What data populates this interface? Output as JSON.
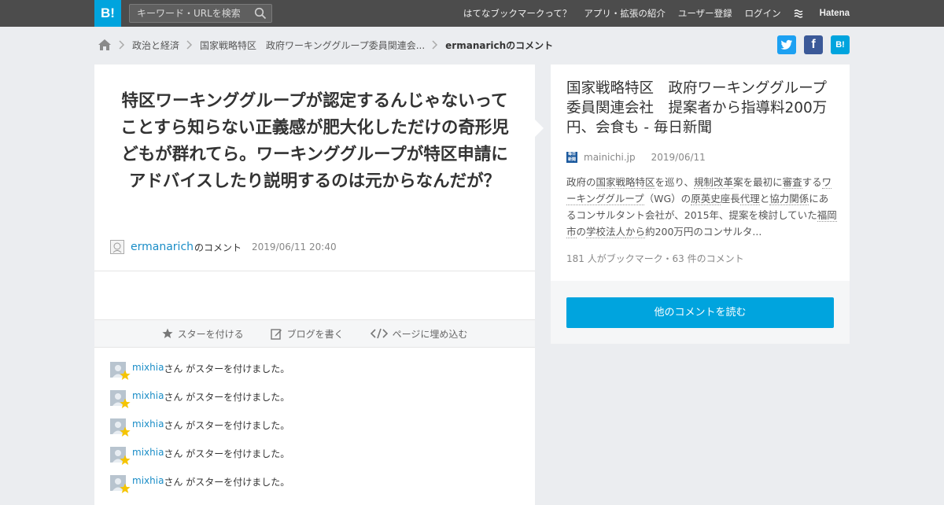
{
  "header": {
    "logo_text": "B!",
    "search_placeholder": "キーワード・URLを検索",
    "nav": [
      "はてなブックマークって？",
      "アプリ・拡張の紹介",
      "ユーザー登録",
      "ログイン"
    ],
    "hatena_label": "Hatena"
  },
  "breadcrumb": {
    "items": [
      "政治と経済",
      "国家戦略特区　政府ワーキンググループ委員関連会...",
      "ermanarichのコメント"
    ]
  },
  "share": {
    "facebook_label": "f",
    "hatena_label": "B!"
  },
  "comment": {
    "text": "特区ワーキンググループが認定するんじゃないってことすら知らない正義感が肥大化しただけの奇形児どもが群れてら。ワーキンググループが特区申請にアドバイスしたり説明するのは元からなんだが？",
    "user": "ermanarich",
    "suffix": "のコメント",
    "date": "2019/06/11 20:40"
  },
  "actions": {
    "star": "スターを付ける",
    "blog": "ブログを書く",
    "embed": "ページに埋め込む"
  },
  "stars": [
    {
      "user": "mixhia",
      "text": "さん がスターを付けました。"
    },
    {
      "user": "mixhia",
      "text": "さん がスターを付けました。"
    },
    {
      "user": "mixhia",
      "text": "さん がスターを付けました。"
    },
    {
      "user": "mixhia",
      "text": "さん がスターを付けました。"
    },
    {
      "user": "mixhia",
      "text": "さん がスターを付けました。"
    }
  ],
  "entry": {
    "title": "国家戦略特区　政府ワーキンググループ委員関連会社　提案者から指導料200万円、会食も - 毎日新聞",
    "favicon_text": "毎日新聞",
    "domain": "mainichi.jp",
    "date": "2019/06/11",
    "summary_parts": [
      {
        "t": "政府の",
        "kw": false
      },
      {
        "t": "国家戦略特区",
        "kw": true
      },
      {
        "t": "を巡り、",
        "kw": false
      },
      {
        "t": "規制改革",
        "kw": true
      },
      {
        "t": "案を最初に",
        "kw": false
      },
      {
        "t": "審査",
        "kw": true
      },
      {
        "t": "する",
        "kw": false
      },
      {
        "t": "ワーキンググループ",
        "kw": true
      },
      {
        "t": "（WG）の",
        "kw": false
      },
      {
        "t": "原英史",
        "kw": true
      },
      {
        "t": "座長",
        "kw": false
      },
      {
        "t": "代理",
        "kw": true
      },
      {
        "t": "と",
        "kw": false
      },
      {
        "t": "協力関係",
        "kw": true
      },
      {
        "t": "にあるコンサルタント会社が、2015年、提案を検討していた",
        "kw": false
      },
      {
        "t": "福岡市",
        "kw": true
      },
      {
        "t": "の",
        "kw": false
      },
      {
        "t": "学校法人",
        "kw": true
      },
      {
        "t": "から",
        "kw": true
      },
      {
        "t": "約200万円のコンサルタ...",
        "kw": false
      }
    ],
    "counts": "181 人がブックマーク・63 件のコメント",
    "read_more": "他のコメントを読む"
  },
  "colors": {
    "accent": "#00a4de",
    "topbar": "#4c4c4c",
    "link": "#1a8dc7",
    "star": "#f5c400"
  }
}
